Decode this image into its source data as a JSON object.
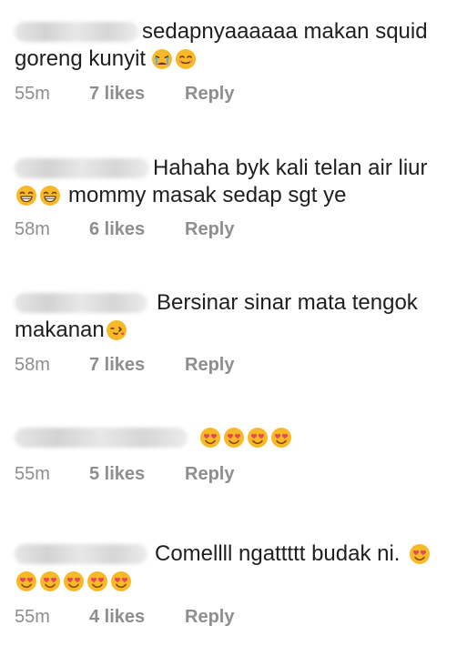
{
  "comments": [
    {
      "text_line1": "sedapnyaaaaaa makan squid",
      "text_line2": "goreng kunyit",
      "time": "55m",
      "likes": "7 likes",
      "reply": "Reply",
      "emojis_line2": [
        "crying-face-emoji",
        "smiling-face-emoji"
      ]
    },
    {
      "text_line1": "Hahaha byk kali telan air liur",
      "text_line2": "mommy masak sedap sgt ye",
      "time": "58m",
      "likes": "6 likes",
      "reply": "Reply",
      "emojis_line2": [
        "laughing-face-emoji",
        "laughing-face-emoji"
      ]
    },
    {
      "text_line1": "Bersinar sinar mata tengok",
      "text_line2": "makanan",
      "time": "58m",
      "likes": "7 likes",
      "reply": "Reply",
      "emojis_line2": [
        "winking-kiss-face-emoji"
      ]
    },
    {
      "text_line1": "",
      "time": "55m",
      "likes": "5 likes",
      "reply": "Reply",
      "emojis_line1": [
        "heart-eyes-emoji",
        "heart-eyes-emoji",
        "heart-eyes-emoji",
        "heart-eyes-emoji"
      ]
    },
    {
      "text_line1": "Comellll ngattttt budak ni.",
      "time": "55m",
      "likes": "4 likes",
      "reply": "Reply",
      "emojis_line1": [
        "heart-eyes-emoji"
      ],
      "emojis_line2": [
        "heart-eyes-emoji",
        "heart-eyes-emoji",
        "heart-eyes-emoji",
        "heart-eyes-emoji",
        "heart-eyes-emoji"
      ]
    }
  ],
  "colors": {
    "text": "#1f1f1f",
    "meta": "#8e8e8e",
    "emoji_face": "#f7b928",
    "emoji_heart": "#e8445a"
  }
}
